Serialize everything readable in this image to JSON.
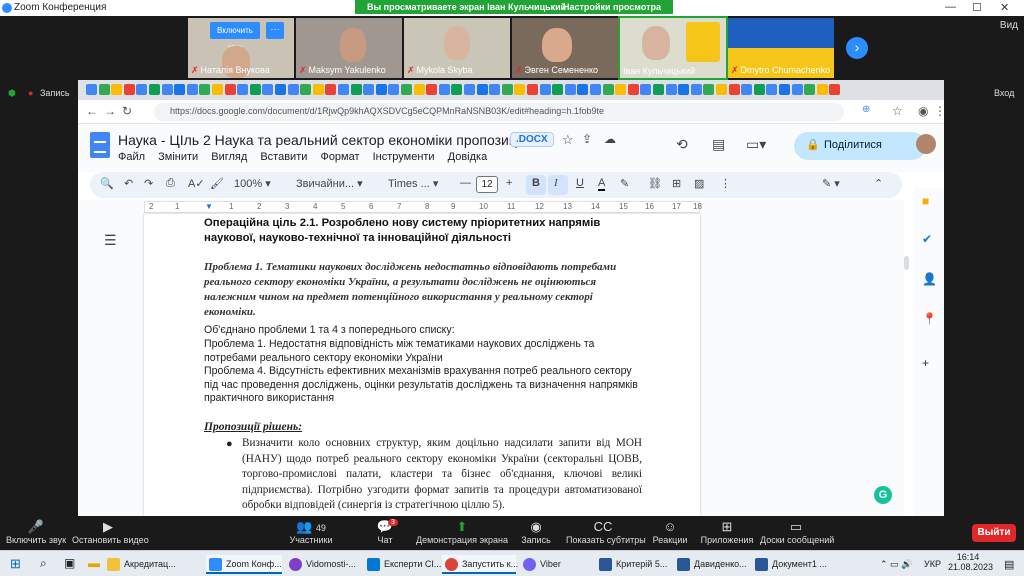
{
  "zoom": {
    "window_title": "Zoom Конференция",
    "share_notice": "Вы просматриваете экран Іван Кульчицький",
    "view_options": "Настройки просмотра",
    "view_label": "Вид",
    "exit_label": "Вход",
    "record_label": "Запись",
    "unmute_button": "Включить звук",
    "participants": [
      {
        "name": "Наталія Внукова"
      },
      {
        "name": "Maksym Yakulenko"
      },
      {
        "name": "Mykola Skyba"
      },
      {
        "name": "Эвген  Семененко"
      },
      {
        "name": "Іван Кульчицький"
      },
      {
        "name": "Dmytro Chumachenko"
      }
    ],
    "bottom_bar": {
      "unmute": "Включить звук",
      "video": "Остановить видео",
      "participants_count": "49",
      "participants": "Участники",
      "chat": "Чат",
      "chat_badge": "3",
      "share": "Демонстрация экрана",
      "record": "Запись",
      "subtitles": "Показать субтитры",
      "reactions": "Реакции",
      "apps": "Приложения",
      "whiteboards": "Доски сообщений",
      "leave": "Выйти"
    }
  },
  "browser": {
    "url": "https://docs.google.com/document/d/1RjwQp9khAQXSDVCg5eCQPMnRaNSNB03K/edit#heading=h.1fob9te"
  },
  "docs": {
    "title": "Наука - ЦІль 2  Наука та реальний сектор економіки пропозиції...",
    "badge": ".DOCX",
    "menu": [
      "Файл",
      "Змінити",
      "Вигляд",
      "Вставити",
      "Формат",
      "Інструменти",
      "Довідка"
    ],
    "share_button": "Поділитися",
    "toolbar": {
      "zoom": "100%",
      "style": "Звичайни...",
      "font": "Times ...",
      "font_size": "12"
    },
    "ruler_ticks": [
      "2",
      "1",
      "1",
      "2",
      "3",
      "4",
      "5",
      "6",
      "7",
      "8",
      "9",
      "10",
      "11",
      "12",
      "13",
      "14",
      "15",
      "16",
      "17",
      "18"
    ],
    "content": {
      "heading": "Операційна ціль 2.1. Розроблено нову систему пріоритетних напрямів наукової, науково-технічної та інноваційної діяльності",
      "problem": "Проблема 1. Тематики наукових досліджень недостатньо відповідають потребами реального сектору економіки України, а результати досліджень не оцінюються належним чином на предмет потенційного використання у реальному секторі економіки.",
      "p1": "Об'єднано проблеми 1 та 4 з попереднього списку:",
      "p2": "Проблема 1. Недостатня відповідність між тематиками наукових досліджень та потребами реального сектору економіки України",
      "p3": "Проблема 4. Відсутність ефективних механізмів врахування потреб реального сектору під час проведення досліджень, оцінки результатів досліджень та визначення напрямків практичного використання",
      "subheading": "Пропозиції рішень:",
      "bullet": "Визначити коло основних структур, яким доцільно надсилати запити від МОН (НАНУ) щодо потреб реального сектору економіки України (секторальні ЦОВВ, торгово-промислові палати, кластери та бізнес об'єднання, ключові великі підприємства). Потрібно узгодити формат запитів та процедури автоматизованої обробки відповідей (синергія із стратегічною ціллю 5)."
    }
  },
  "taskbar": {
    "items": [
      "Акредитац...",
      "Zoom Конф...",
      "Vidomosti-...",
      "Експерти CI...",
      "Запустить к...",
      "Viber",
      "Критерій 5...",
      "Давиденко...",
      "Документ1 ..."
    ],
    "lang": "УКР",
    "time": "16:14",
    "date": "21.08.2023"
  },
  "colors": {
    "zoom_green": "#21a336",
    "docs_blue": "#4285f4",
    "share_btn": "#c2e7ff",
    "leave_red": "#e02828"
  }
}
